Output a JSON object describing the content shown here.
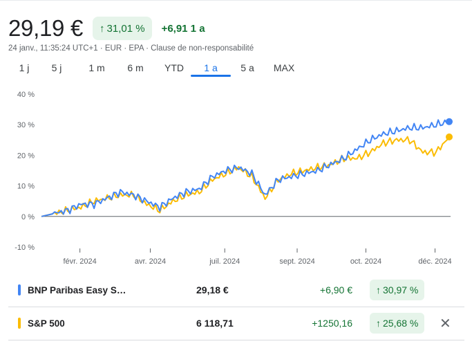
{
  "quote": {
    "price": "29,19 €",
    "pct_arrow": "↑",
    "pct_change": "31,01 %",
    "abs_change": "+6,91 1 a",
    "meta": "24 janv., 11:35:24 UTC+1 · EUR · EPA · Clause de non-responsabilité"
  },
  "ranges": [
    {
      "label": "1 j",
      "active": false
    },
    {
      "label": "5 j",
      "active": false
    },
    {
      "label": "1 m",
      "active": false
    },
    {
      "label": "6 m",
      "active": false
    },
    {
      "label": "YTD",
      "active": false
    },
    {
      "label": "1 a",
      "active": true
    },
    {
      "label": "5 a",
      "active": false
    },
    {
      "label": "MAX",
      "active": false
    }
  ],
  "colors": {
    "blue": "#4285f4",
    "yellow": "#fbbc04",
    "positive": "#137333",
    "badge_bg": "#e6f4ea"
  },
  "chart_data": {
    "type": "line",
    "y_ticks": [
      "40 %",
      "30 %",
      "20 %",
      "10 %",
      "0 %",
      "-10 %"
    ],
    "y_tick_values": [
      40,
      30,
      20,
      10,
      0,
      -10
    ],
    "ylim": [
      -10,
      40
    ],
    "x_ticks": [
      "févr. 2024",
      "avr. 2024",
      "juil. 2024",
      "sept. 2024",
      "oct. 2024",
      "déc. 2024"
    ],
    "x_tick_positions": [
      0.094,
      0.266,
      0.448,
      0.625,
      0.793,
      0.962
    ],
    "series": [
      {
        "name": "BNP Paribas Easy S…",
        "color": "#4285f4",
        "values": [
          0,
          1,
          2,
          4,
          4,
          6,
          8,
          7,
          5,
          3,
          6,
          8,
          9,
          13,
          15,
          16,
          14,
          7,
          12,
          13,
          14,
          15,
          17,
          19,
          22,
          25,
          27,
          28,
          29,
          29,
          30,
          31
        ]
      },
      {
        "name": "S&P 500",
        "color": "#fbbc04",
        "values": [
          0,
          1,
          2,
          3,
          5,
          6,
          7,
          7,
          4,
          2,
          5,
          7,
          8,
          12,
          14,
          16,
          13,
          6,
          12,
          14,
          15,
          16,
          17,
          19,
          19,
          21,
          24,
          25,
          25,
          21,
          21,
          26
        ]
      }
    ]
  },
  "comparisons": [
    {
      "name": "BNP Paribas Easy S…",
      "value": "29,18 €",
      "change": "+6,90 €",
      "pct_arrow": "↑",
      "pct": "30,97 %",
      "color": "#4285f4",
      "removable": false
    },
    {
      "name": "S&P 500",
      "value": "6 118,71",
      "change": "+1250,16",
      "pct_arrow": "↑",
      "pct": "25,68 %",
      "color": "#fbbc04",
      "removable": true,
      "close_glyph": "✕"
    }
  ]
}
